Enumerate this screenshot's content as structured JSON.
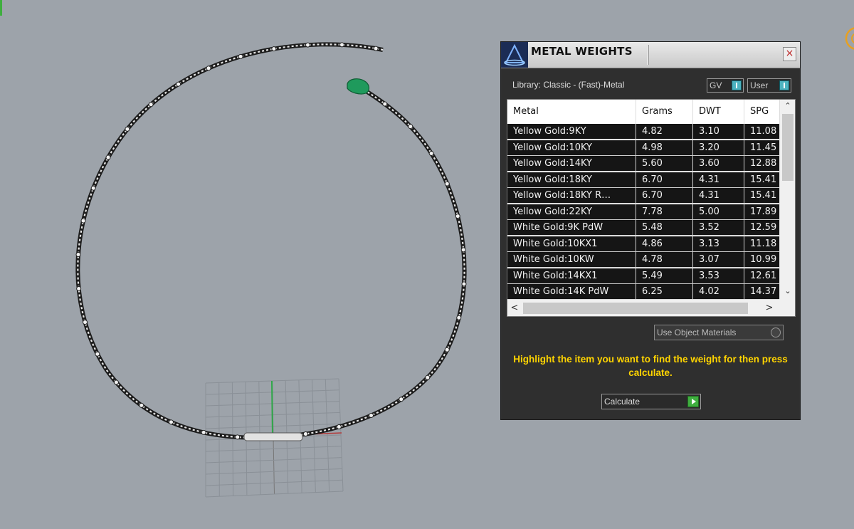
{
  "panel": {
    "title": "METAL WEIGHTS",
    "close_glyph": "×",
    "library_label": "Library: Classic - (Fast)-Metal",
    "toggle_gv": "GV",
    "toggle_user": "User",
    "columns": [
      "Metal",
      "Grams",
      "DWT",
      "SPG"
    ],
    "rows": [
      [
        "Yellow Gold:9KY",
        "4.82",
        "3.10",
        "11.08"
      ],
      [
        "Yellow Gold:10KY",
        "4.98",
        "3.20",
        "11.45"
      ],
      [
        "Yellow Gold:14KY",
        "5.60",
        "3.60",
        "12.88"
      ],
      [
        "Yellow Gold:18KY",
        "6.70",
        "4.31",
        "15.41"
      ],
      [
        "Yellow Gold:18KY R…",
        "6.70",
        "4.31",
        "15.41"
      ],
      [
        "Yellow Gold:22KY",
        "7.78",
        "5.00",
        "17.89"
      ],
      [
        "White Gold:9K PdW",
        "5.48",
        "3.52",
        "12.59"
      ],
      [
        "White Gold:10KX1",
        "4.86",
        "3.13",
        "11.18"
      ],
      [
        "White Gold:10KW",
        "4.78",
        "3.07",
        "10.99"
      ],
      [
        "White Gold:14KX1",
        "5.49",
        "3.53",
        "12.61"
      ],
      [
        "White Gold:14K PdW",
        "6.25",
        "4.02",
        "14.37"
      ]
    ],
    "use_object_materials": "Use Object Materials",
    "hint": "Highlight the item you want to find the weight for then press calculate.",
    "calculate_label": "Calculate",
    "icons": {
      "scroll_up": "⌃",
      "scroll_down": "⌄",
      "scroll_left": "<",
      "scroll_right": ">"
    }
  },
  "colors": {
    "viewport_bg": "#9da3aa",
    "panel_bg": "#2f2f2f",
    "hint_text": "#ffd400",
    "toggle_knob": "#4db3c0",
    "calculate_go": "#3fae3f",
    "clasp": "#1f9a5c",
    "axis_x": "#b33a3a",
    "axis_y": "#2fa84a"
  }
}
